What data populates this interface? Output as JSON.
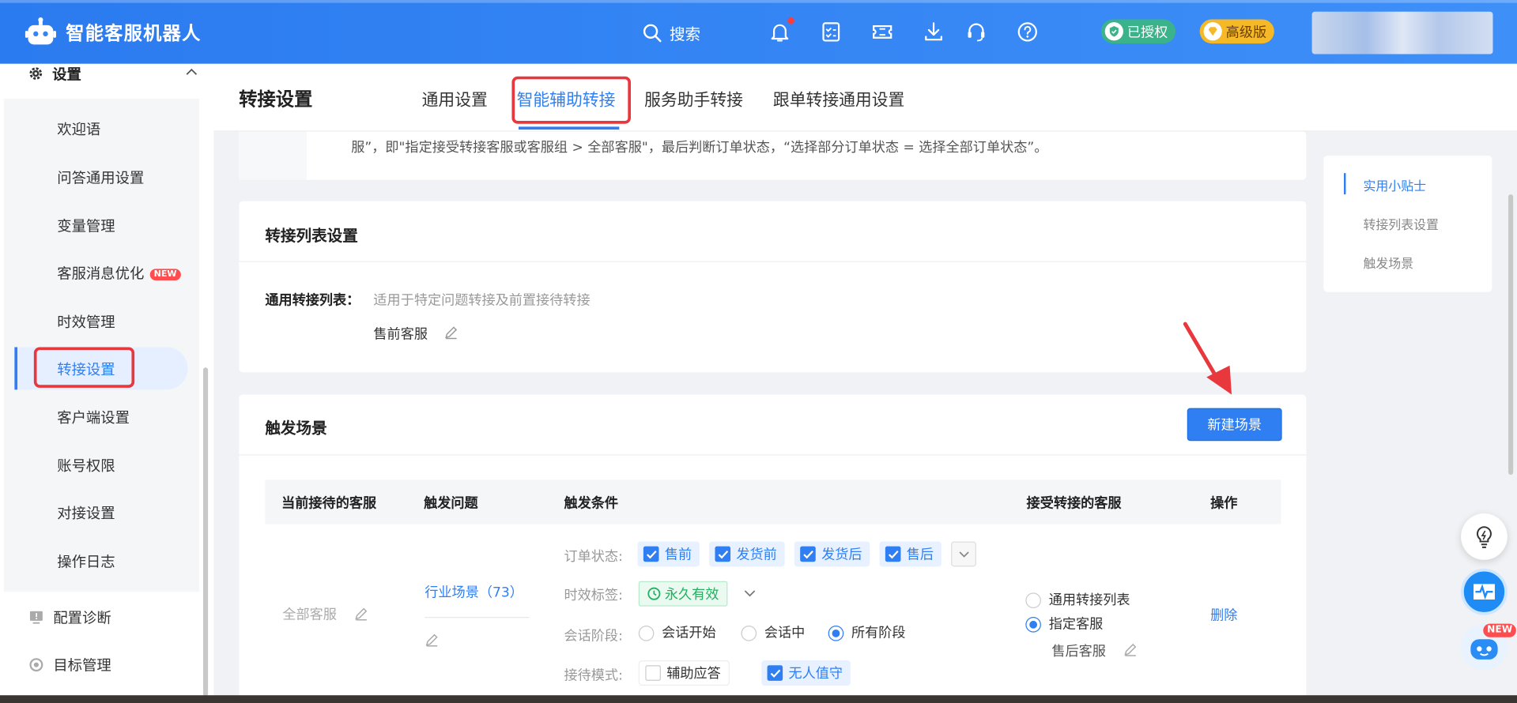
{
  "app": {
    "title": "智能客服机器人"
  },
  "topbar": {
    "search_label": "搜索",
    "authorized_label": "已授权",
    "edition_label": "高级版",
    "icons": [
      "bell-icon",
      "checklist-icon",
      "ticket-icon",
      "download-icon",
      "headset-icon",
      "help-icon"
    ]
  },
  "sidebar": {
    "section_title": "设置",
    "items": [
      {
        "label": "欢迎语"
      },
      {
        "label": "问答通用设置"
      },
      {
        "label": "变量管理"
      },
      {
        "label": "客服消息优化",
        "badge": "NEW"
      },
      {
        "label": "时效管理"
      },
      {
        "label": "转接设置",
        "active": true
      },
      {
        "label": "客户端设置"
      },
      {
        "label": "账号权限"
      },
      {
        "label": "对接设置"
      },
      {
        "label": "操作日志"
      }
    ],
    "footer_items": [
      {
        "label": "配置诊断"
      },
      {
        "label": "目标管理"
      }
    ]
  },
  "header": {
    "title": "转接设置",
    "tabs": [
      {
        "label": "通用设置"
      },
      {
        "label": "智能辅助转接",
        "active": true
      },
      {
        "label": "服务助手转接"
      },
      {
        "label": "跟单转接通用设置"
      }
    ]
  },
  "tip": {
    "text": "服”，即\"指定接受转接客服或客服组 > 全部客服\"，最后判断订单状态，“选择部分订单状态 = 选择全部订单状态”。"
  },
  "transfer_list": {
    "title": "转接列表设置",
    "general_label": "通用转接列表：",
    "general_hint": "适用于特定问题转接及前置接待转接",
    "general_value": "售前客服"
  },
  "scenes": {
    "title": "触发场景",
    "new_button": "新建场景",
    "columns": [
      "当前接待的客服",
      "触发问题",
      "触发条件",
      "接受转接的客服",
      "操作"
    ],
    "row": {
      "current_agent": "全部客服",
      "trigger_question": "行业场景（73）",
      "order_status_label": "订单状态:",
      "order_status_options": [
        "售前",
        "发货前",
        "发货后",
        "售后"
      ],
      "time_tag_label": "时效标签:",
      "time_tag_value": "永久有效",
      "session_stage_label": "会话阶段:",
      "session_stage_options": [
        "会话开始",
        "会话中",
        "所有阶段"
      ],
      "session_stage_selected": "所有阶段",
      "reception_mode_label": "接待模式:",
      "reception_mode_options": [
        {
          "label": "辅助应答",
          "checked": false
        },
        {
          "label": "无人值守",
          "checked": true
        }
      ],
      "receiver_options": [
        "通用转接列表",
        "指定客服"
      ],
      "receiver_selected": "指定客服",
      "receiver_value": "售后客服",
      "action": "删除"
    }
  },
  "right_panel": {
    "items": [
      {
        "label": "实用小贴士",
        "active": true
      },
      {
        "label": "转接列表设置"
      },
      {
        "label": "触发场景"
      }
    ]
  },
  "colors": {
    "primary": "#2f7ff2",
    "topbar": "#3384f4",
    "highlight_box": "#e8383d",
    "success": "#23b060"
  }
}
